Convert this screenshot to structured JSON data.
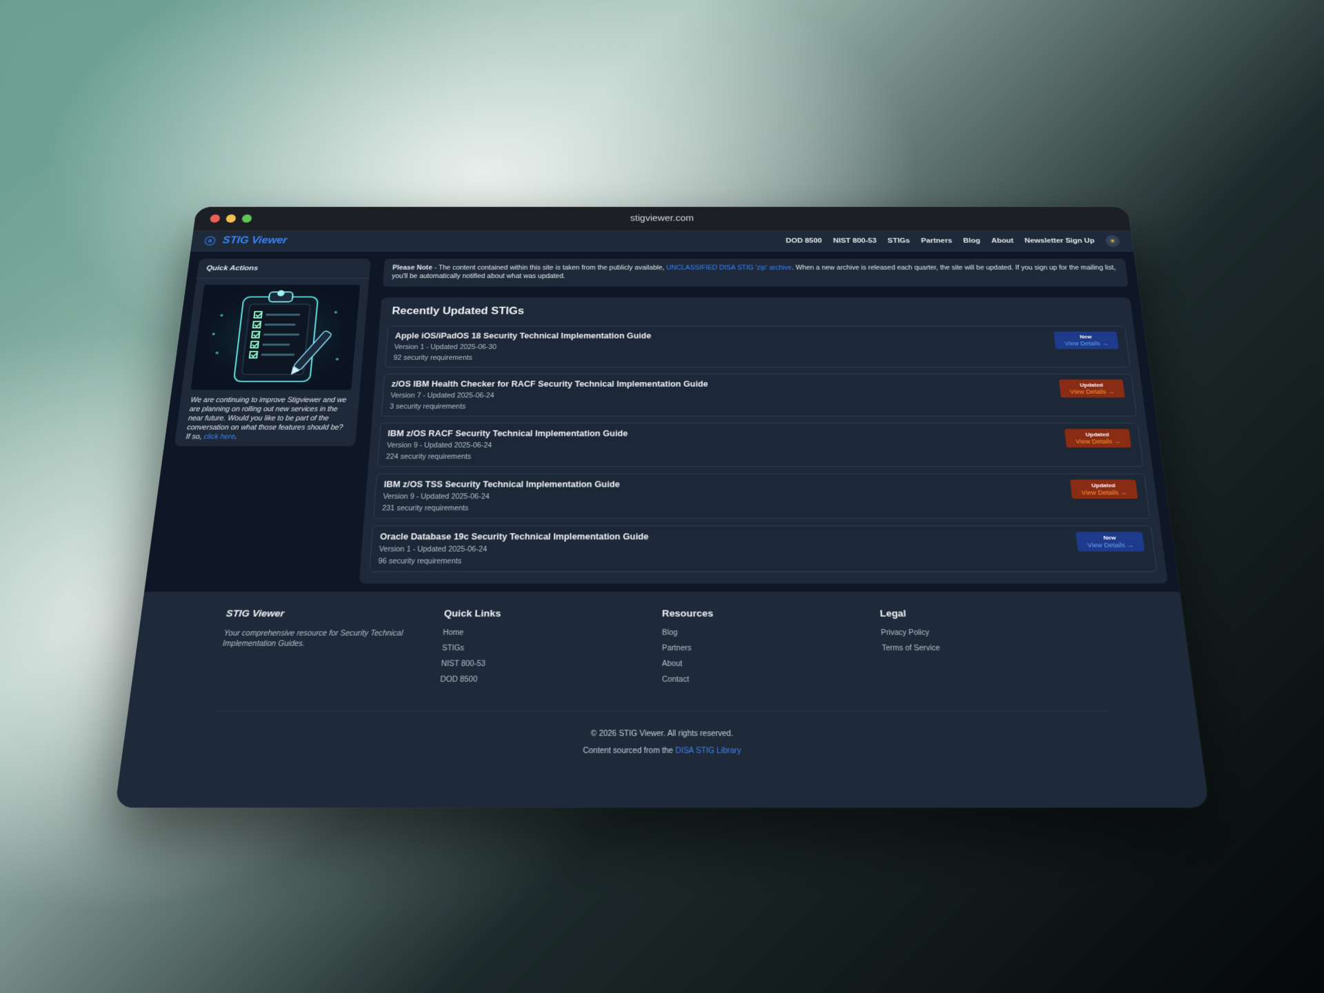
{
  "browser": {
    "url": "stigviewer.com"
  },
  "nav": {
    "brand": "STIG Viewer",
    "links": [
      "DOD 8500",
      "NIST 800-53",
      "STIGs",
      "Partners",
      "Blog",
      "About",
      "Newsletter Sign Up"
    ],
    "theme_icon": "sun-icon"
  },
  "sidebar": {
    "title": "Quick Actions",
    "text": "We are continuing to improve Stigviewer and we are planning on rolling out new services in the near future. Would you like to be part of the conversation on what those features should be? If so,",
    "link": "click here",
    "end": "."
  },
  "notice": {
    "lead": "Please Note",
    "text1": " - The content contained within this site is taken from the publicly available, ",
    "link": "UNCLASSIFIED DISA STIG 'zip' archive",
    "text2": ". When a new archive is released each quarter, the site will be updated. If you sign up for the mailing list, you'll be automatically notified about what was updated."
  },
  "recent": {
    "heading": "Recently Updated STIGs",
    "items": [
      {
        "title": "Apple iOS/iPadOS 18 Security Technical Implementation Guide",
        "version": "Version 1 - Updated 2025-06-30",
        "reqs": "92 security requirements",
        "badge": "New",
        "action": "View Details →"
      },
      {
        "title": "z/OS IBM Health Checker for RACF Security Technical Implementation Guide",
        "version": "Version 7 - Updated 2025-06-24",
        "reqs": "3 security requirements",
        "badge": "Updated",
        "action": "View Details →"
      },
      {
        "title": "IBM z/OS RACF Security Technical Implementation Guide",
        "version": "Version 9 - Updated 2025-06-24",
        "reqs": "224 security requirements",
        "badge": "Updated",
        "action": "View Details →"
      },
      {
        "title": "IBM z/OS TSS Security Technical Implementation Guide",
        "version": "Version 9 - Updated 2025-06-24",
        "reqs": "231 security requirements",
        "badge": "Updated",
        "action": "View Details →"
      },
      {
        "title": "Oracle Database 19c Security Technical Implementation Guide",
        "version": "Version 1 - Updated 2025-06-24",
        "reqs": "96 security requirements",
        "badge": "New",
        "action": "View Details →"
      }
    ]
  },
  "footer": {
    "brand": "STIG Viewer",
    "tagline": "Your comprehensive resource for Security Technical Implementation Guides.",
    "quick_links": {
      "heading": "Quick Links",
      "items": [
        "Home",
        "STIGs",
        "NIST 800-53",
        "DOD 8500"
      ]
    },
    "resources": {
      "heading": "Resources",
      "items": [
        "Blog",
        "Partners",
        "About",
        "Contact"
      ]
    },
    "legal": {
      "heading": "Legal",
      "items": [
        "Privacy Policy",
        "Terms of Service"
      ]
    },
    "copyright": "© 2026 STIG Viewer. All rights reserved.",
    "sourced_prefix": "Content sourced from the ",
    "sourced_link": "DISA STIG Library"
  },
  "colors": {
    "accent": "#3b82f6",
    "badge_new": "#1e3a8a",
    "badge_updated": "#8a2c14"
  }
}
